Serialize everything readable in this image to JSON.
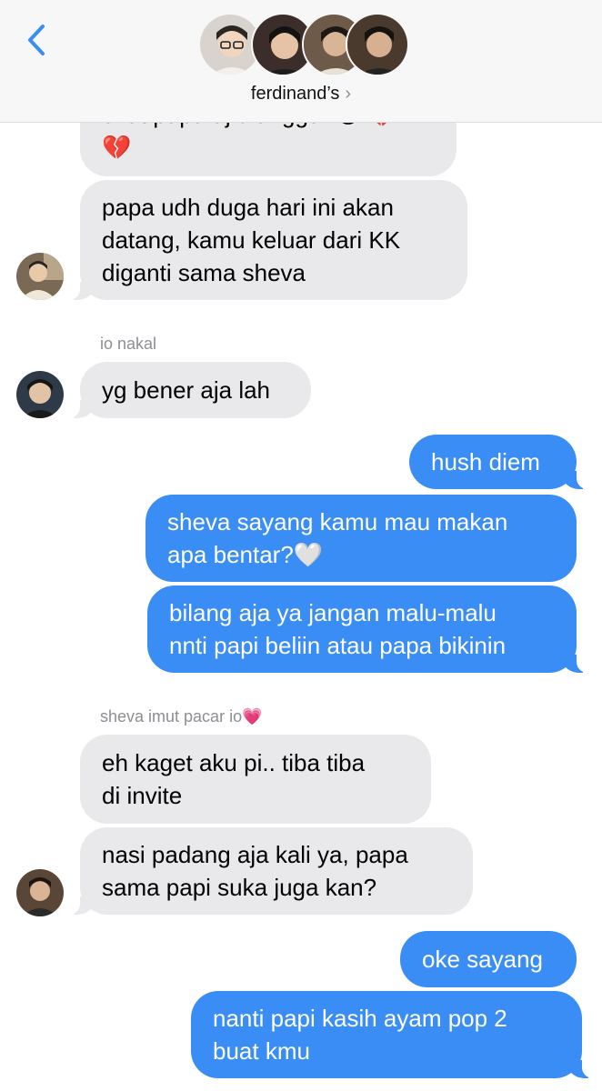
{
  "header": {
    "group_name": "ferdinand’s",
    "chevron": "›",
    "back_icon": "chevron-left-icon",
    "accent": "#3a8df5"
  },
  "messages": {
    "m0": {
      "text": "chat papa aj dianggur 😅 💔\n💔"
    },
    "m1": {
      "text": "papa udh duga hari ini akan\ndatang, kamu keluar dari KK\ndiganti sama sheva"
    },
    "sender1": "io nakal",
    "m2": {
      "text": "yg bener aja lah"
    },
    "m3": {
      "text": "hush diem"
    },
    "m4": {
      "text": "sheva sayang kamu mau makan\napa bentar?🤍"
    },
    "m5": {
      "text": "bilang aja ya jangan malu-malu\nnnti papi beliin atau papa bikinin"
    },
    "sender2": "sheva imut pacar io💗",
    "m6": {
      "text": "eh kaget aku pi.. tiba tiba\ndi invite"
    },
    "m7": {
      "text": "nasi padang aja kali ya, papa\nsama papi suka juga kan?"
    },
    "m8": {
      "text": "oke sayang"
    },
    "m9": {
      "text": "nanti papi kasih ayam pop 2\nbuat kmu"
    }
  },
  "colors": {
    "sent_bubble": "#3a8df5",
    "received_bubble": "#e9e9eb",
    "header_bg": "#f7f7f7"
  }
}
